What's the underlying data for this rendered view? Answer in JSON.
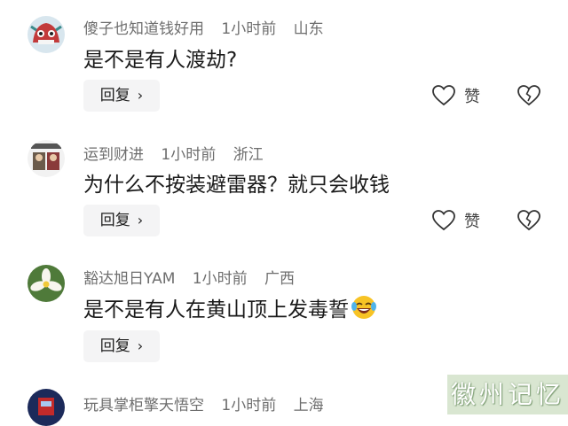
{
  "comments": [
    {
      "username": "傻子也知道钱好用",
      "time": "1小时前",
      "location": "山东",
      "text": "是不是有人渡劫?",
      "reply_label": "回复",
      "like_label": "赞"
    },
    {
      "username": "运到财进",
      "time": "1小时前",
      "location": "浙江",
      "text": "为什么不按装避雷器？就只会收钱",
      "reply_label": "回复",
      "like_label": "赞"
    },
    {
      "username": "豁达旭日YAM",
      "time": "1小时前",
      "location": "广西",
      "text": "是不是有人在黄山顶上发毒誓",
      "reply_label": "回复",
      "emoji": "laughing-crying-emoji"
    },
    {
      "username": "玩具掌柜擎天悟空",
      "time": "1小时前",
      "location": "上海"
    }
  ],
  "watermark": "徽州记忆",
  "icons": {
    "like": "heart-outline-icon",
    "dislike": "broken-heart-icon",
    "chevron": "chevron-right-icon"
  }
}
